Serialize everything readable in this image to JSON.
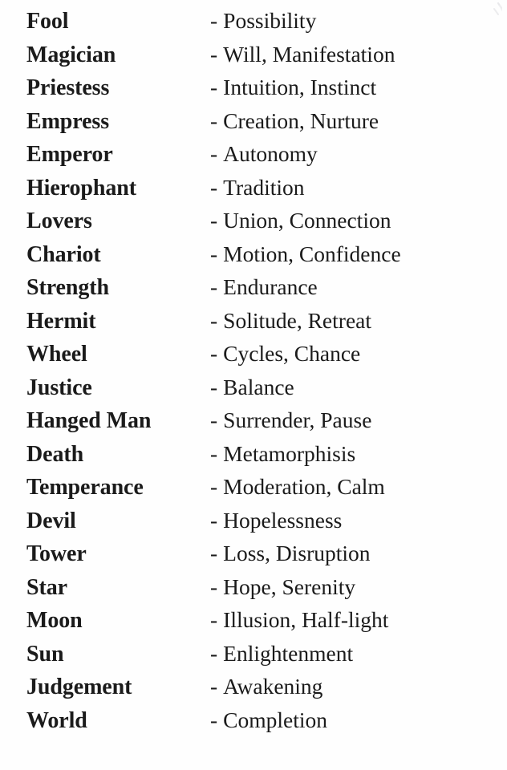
{
  "page": {
    "background_color": "#fefefe",
    "text_color": "#1b1b1b",
    "separator": "-"
  },
  "artifact": {
    "name": "scan-artifact",
    "color": "#d8d8dc"
  },
  "list": {
    "rows": [
      {
        "card": "Fool",
        "meaning": "Possibility"
      },
      {
        "card": "Magician",
        "meaning": "Will, Manifestation"
      },
      {
        "card": "Priestess",
        "meaning": "Intuition, Instinct"
      },
      {
        "card": "Empress",
        "meaning": "Creation, Nurture"
      },
      {
        "card": "Emperor",
        "meaning": "Autonomy"
      },
      {
        "card": "Hierophant",
        "meaning": "Tradition"
      },
      {
        "card": "Lovers",
        "meaning": "Union, Connection"
      },
      {
        "card": "Chariot",
        "meaning": "Motion, Confidence"
      },
      {
        "card": "Strength",
        "meaning": "Endurance"
      },
      {
        "card": "Hermit",
        "meaning": "Solitude, Retreat"
      },
      {
        "card": "Wheel",
        "meaning": "Cycles, Chance"
      },
      {
        "card": "Justice",
        "meaning": "Balance"
      },
      {
        "card": "Hanged Man",
        "meaning": "Surrender, Pause"
      },
      {
        "card": "Death",
        "meaning": "Metamorphisis"
      },
      {
        "card": "Temperance",
        "meaning": "Moderation, Calm"
      },
      {
        "card": "Devil",
        "meaning": "Hopelessness"
      },
      {
        "card": "Tower",
        "meaning": "Loss, Disruption"
      },
      {
        "card": "Star",
        "meaning": "Hope, Serenity"
      },
      {
        "card": "Moon",
        "meaning": "Illusion, Half-light"
      },
      {
        "card": "Sun",
        "meaning": "Enlightenment"
      },
      {
        "card": "Judgement",
        "meaning": "Awakening"
      },
      {
        "card": "World",
        "meaning": "Completion"
      }
    ]
  }
}
